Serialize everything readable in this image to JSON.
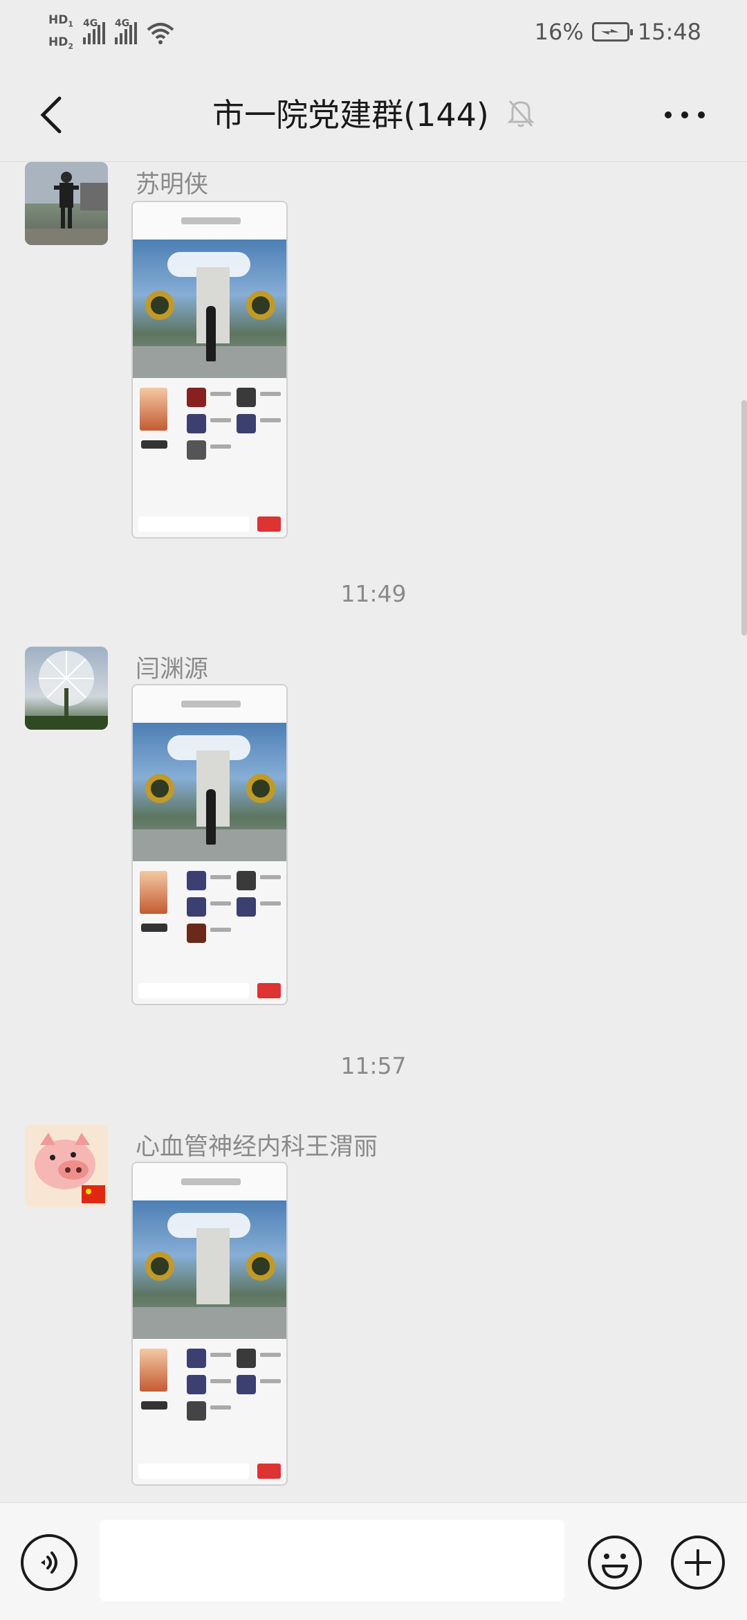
{
  "status_bar": {
    "hd1": "HD",
    "hd2": "HD",
    "net1": "4G",
    "net2": "4G",
    "battery": "16%",
    "time": "15:48"
  },
  "header": {
    "title": "市一院党建群(144)",
    "icons": {
      "back": "chevron-left-icon",
      "mute": "bell-off-icon",
      "more": "more-dots-icon"
    }
  },
  "messages": [
    {
      "sender": "苏明侠",
      "type": "image"
    },
    {
      "sender": "闫渊源",
      "type": "image"
    },
    {
      "sender": "心血管神经内科王渭丽",
      "type": "image"
    }
  ],
  "timestamps": [
    "11:49",
    "11:57"
  ],
  "input_bar": {
    "text": "",
    "icons": {
      "voice": "voice-icon",
      "emoji": "emoji-icon",
      "plus": "plus-icon"
    }
  },
  "colors": {
    "background": "#ededed",
    "input_bar": "#f6f6f6",
    "text_secondary": "#8a8a8a"
  }
}
